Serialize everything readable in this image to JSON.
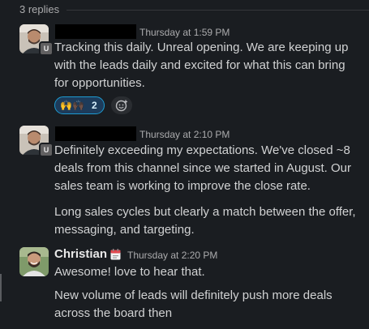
{
  "thread": {
    "replies_label": "3 replies"
  },
  "messages": [
    {
      "timestamp": "Thursday at 1:59 PM",
      "badge": "U",
      "paragraphs": [
        "Tracking this daily.  Unreal opening. We are keeping up with the leads daily and excited for what this can bring for opportunities."
      ],
      "reaction": {
        "emoji": "🙌🙌🏿",
        "count": "2"
      }
    },
    {
      "timestamp": "Thursday at 2:10 PM",
      "badge": "U",
      "paragraphs": [
        "Definitely exceeding my expectations. We've closed ~8 deals from this channel since we started in August. Our sales team is working to improve the close rate.",
        "Long sales cycles but clearly a match between the offer, messaging, and targeting."
      ]
    },
    {
      "sender": "Christian",
      "timestamp": "Thursday at 2:20 PM",
      "paragraphs": [
        "Awesome! love to hear that.",
        "New volume of leads will definitely push more deals across the board then"
      ]
    }
  ],
  "icons": {
    "add_reaction": "add-reaction-icon",
    "status": "calendar-icon"
  },
  "colors": {
    "background": "#1a1d21",
    "text": "#d1d2d3",
    "muted": "#ababad",
    "reaction_border": "#1d9bd1"
  }
}
